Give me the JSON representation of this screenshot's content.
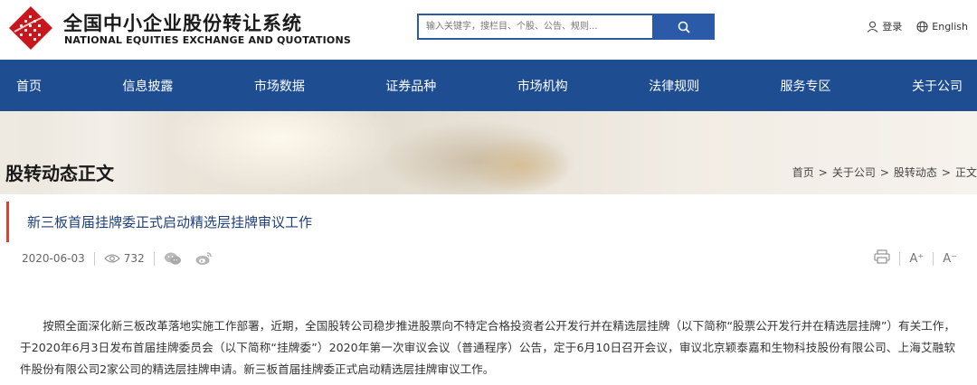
{
  "header": {
    "brand_cn": "全国中小企业股份转让系统",
    "brand_en": "NATIONAL EQUITIES EXCHANGE AND QUOTATIONS",
    "search_placeholder": "输入关键字，搜栏目、个股、公告、规则...",
    "login_label": "登录",
    "english_label": "English",
    "icons": {
      "search": "search-icon",
      "user": "user-icon",
      "globe": "globe-icon",
      "logo": "neeq-logo-icon"
    },
    "colors": {
      "brand_blue": "#1e4d92",
      "search_blue": "#2b5ba8",
      "logo_red": "#c8161d"
    }
  },
  "nav": {
    "items": [
      "首页",
      "信息披露",
      "市场数据",
      "证券品种",
      "市场机构",
      "法律规则",
      "服务专区",
      "关于公司"
    ]
  },
  "banner": {
    "page_title": "股转动态正文",
    "breadcrumb": [
      "首页",
      "关于公司",
      "股转动态",
      "正文"
    ],
    "breadcrumb_sep": ">"
  },
  "article": {
    "title": "新三板首届挂牌委正式启动精选层挂牌审议工作",
    "date": "2020-06-03",
    "views": "732",
    "font_increase": "A⁺",
    "font_decrease": "A⁻",
    "icons": {
      "views": "eye-icon",
      "wechat": "wechat-icon",
      "weibo": "weibo-icon",
      "print": "print-icon"
    },
    "accent_color": "#e0412f",
    "body": "按照全面深化新三板改革落地实施工作部署，近期，全国股转公司稳步推进股票向不特定合格投资者公开发行并在精选层挂牌（以下简称“股票公开发行并在精选层挂牌”）有关工作，于2020年6月3日发布首届挂牌委员会（以下简称“挂牌委”）2020年第一次审议会议（普通程序）公告，定于6月10日召开会议，审议北京颖泰嘉和生物科技股份有限公司、上海艾融软件股份有限公司2家公司的精选层挂牌申请。新三板首届挂牌委正式启动精选层挂牌审议工作。"
  }
}
